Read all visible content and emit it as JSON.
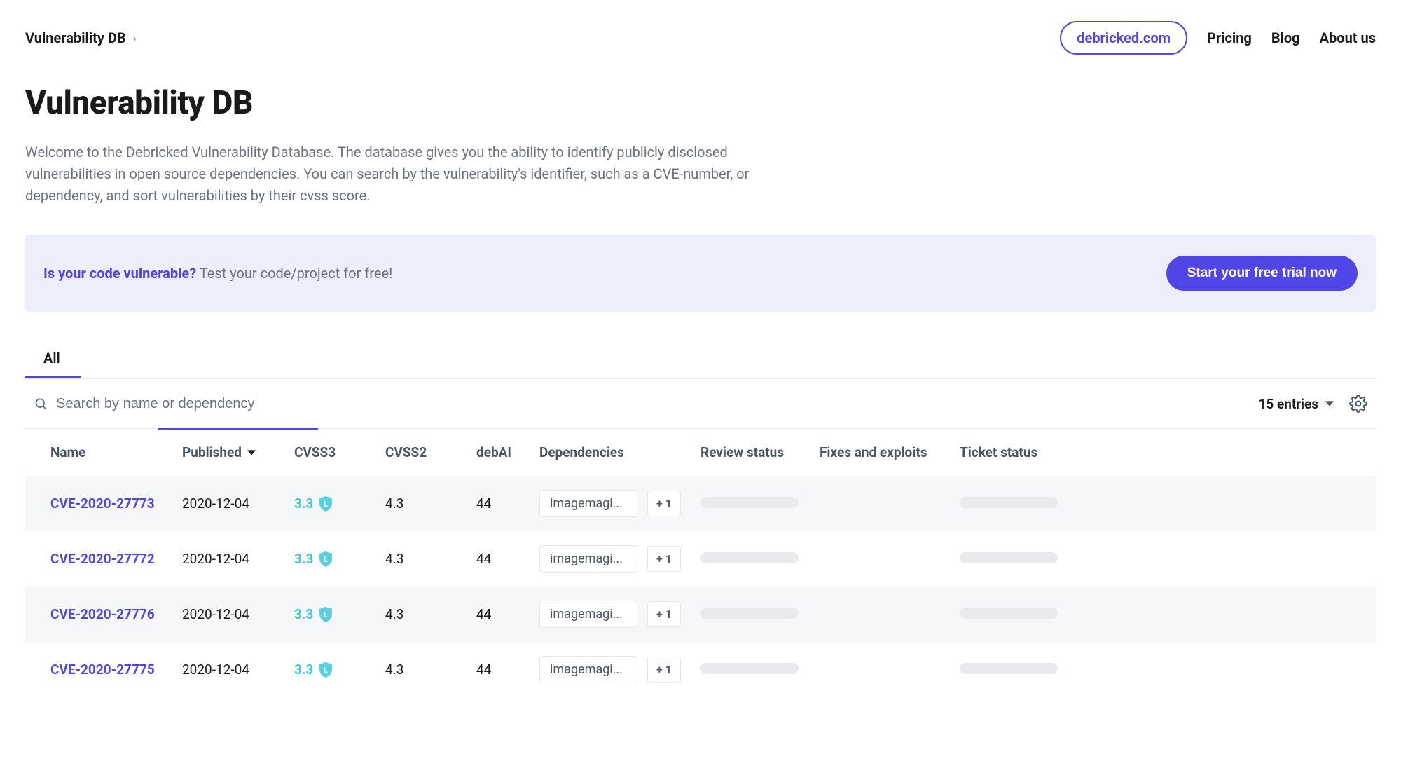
{
  "breadcrumb": {
    "title": "Vulnerability DB"
  },
  "nav": {
    "primary_link": "debricked.com",
    "links": [
      "Pricing",
      "Blog",
      "About us"
    ]
  },
  "page": {
    "title": "Vulnerability DB",
    "intro": "Welcome to the Debricked Vulnerability Database. The database gives you the ability to identify publicly disclosed vulnerabilities in open source dependencies. You can search by the vulnerability's identifier, such as a CVE-number, or dependency, and sort vulnerabilities by their cvss score."
  },
  "banner": {
    "lead": "Is your code vulnerable?",
    "rest": "Test your code/project for free!",
    "cta": "Start your free trial now"
  },
  "tabs": {
    "active": "All"
  },
  "toolbar": {
    "search_placeholder": "Search by name or dependency",
    "entries_label": "15 entries"
  },
  "columns": {
    "name": "Name",
    "published": "Published",
    "cvss3": "CVSS3",
    "cvss2": "CVSS2",
    "debai": "debAI",
    "dependencies": "Dependencies",
    "review": "Review status",
    "fixes": "Fixes and exploits",
    "ticket": "Ticket status"
  },
  "rows": [
    {
      "name": "CVE-2020-27773",
      "published": "2020-12-04",
      "cvss3": "3.3",
      "cvss3_badge": "L",
      "cvss2": "4.3",
      "debai": "44",
      "dep": "imagemagi...",
      "more": "+ 1"
    },
    {
      "name": "CVE-2020-27772",
      "published": "2020-12-04",
      "cvss3": "3.3",
      "cvss3_badge": "L",
      "cvss2": "4.3",
      "debai": "44",
      "dep": "imagemagi...",
      "more": "+ 1"
    },
    {
      "name": "CVE-2020-27776",
      "published": "2020-12-04",
      "cvss3": "3.3",
      "cvss3_badge": "L",
      "cvss2": "4.3",
      "debai": "44",
      "dep": "imagemagi...",
      "more": "+ 1"
    },
    {
      "name": "CVE-2020-27775",
      "published": "2020-12-04",
      "cvss3": "3.3",
      "cvss3_badge": "L",
      "cvss2": "4.3",
      "debai": "44",
      "dep": "imagemagi...",
      "more": "+ 1"
    }
  ]
}
